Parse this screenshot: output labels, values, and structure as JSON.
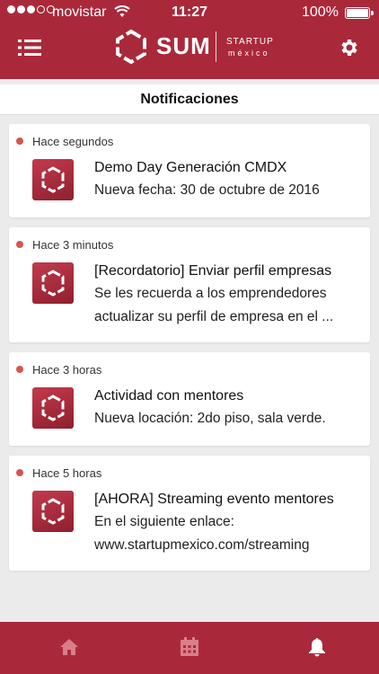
{
  "status_bar": {
    "carrier": "movistar",
    "time": "11:27",
    "battery": "100%",
    "signal_bars_filled": 3,
    "signal_bars_total": 5
  },
  "header": {
    "logo_name": "SUM",
    "logo_tagline_1": "STARTUP",
    "logo_tagline_2": "méxico",
    "menu_icon": "hamburger-menu-icon",
    "settings_icon": "gear-icon"
  },
  "page": {
    "title": "Notificaciones"
  },
  "notifications": [
    {
      "time": "Hace segundos",
      "title": "Demo Day Generación CMDX",
      "body": "Nueva fecha: 30 de octubre de 2016"
    },
    {
      "time": "Hace 3 minutos",
      "title": "[Recordatorio] Enviar perfil empresas",
      "body": "Se les recuerda a los emprendedores actualizar su perfil de empresa en el ..."
    },
    {
      "time": "Hace 3 horas",
      "title": "Actividad con mentores",
      "body": "Nueva locación: 2do piso, sala verde."
    },
    {
      "time": "Hace 5 horas",
      "title": "[AHORA] Streaming evento mentores",
      "body": "En el siguiente enlace: www.startupmexico.com/streaming"
    }
  ],
  "tab_bar": {
    "tabs": [
      {
        "icon": "home-icon",
        "active": false
      },
      {
        "icon": "calendar-icon",
        "active": false
      },
      {
        "icon": "bell-icon",
        "active": true
      }
    ]
  },
  "colors": {
    "brand": "#a9293a",
    "unread_dot": "#d9534f",
    "background": "#ebebeb"
  }
}
